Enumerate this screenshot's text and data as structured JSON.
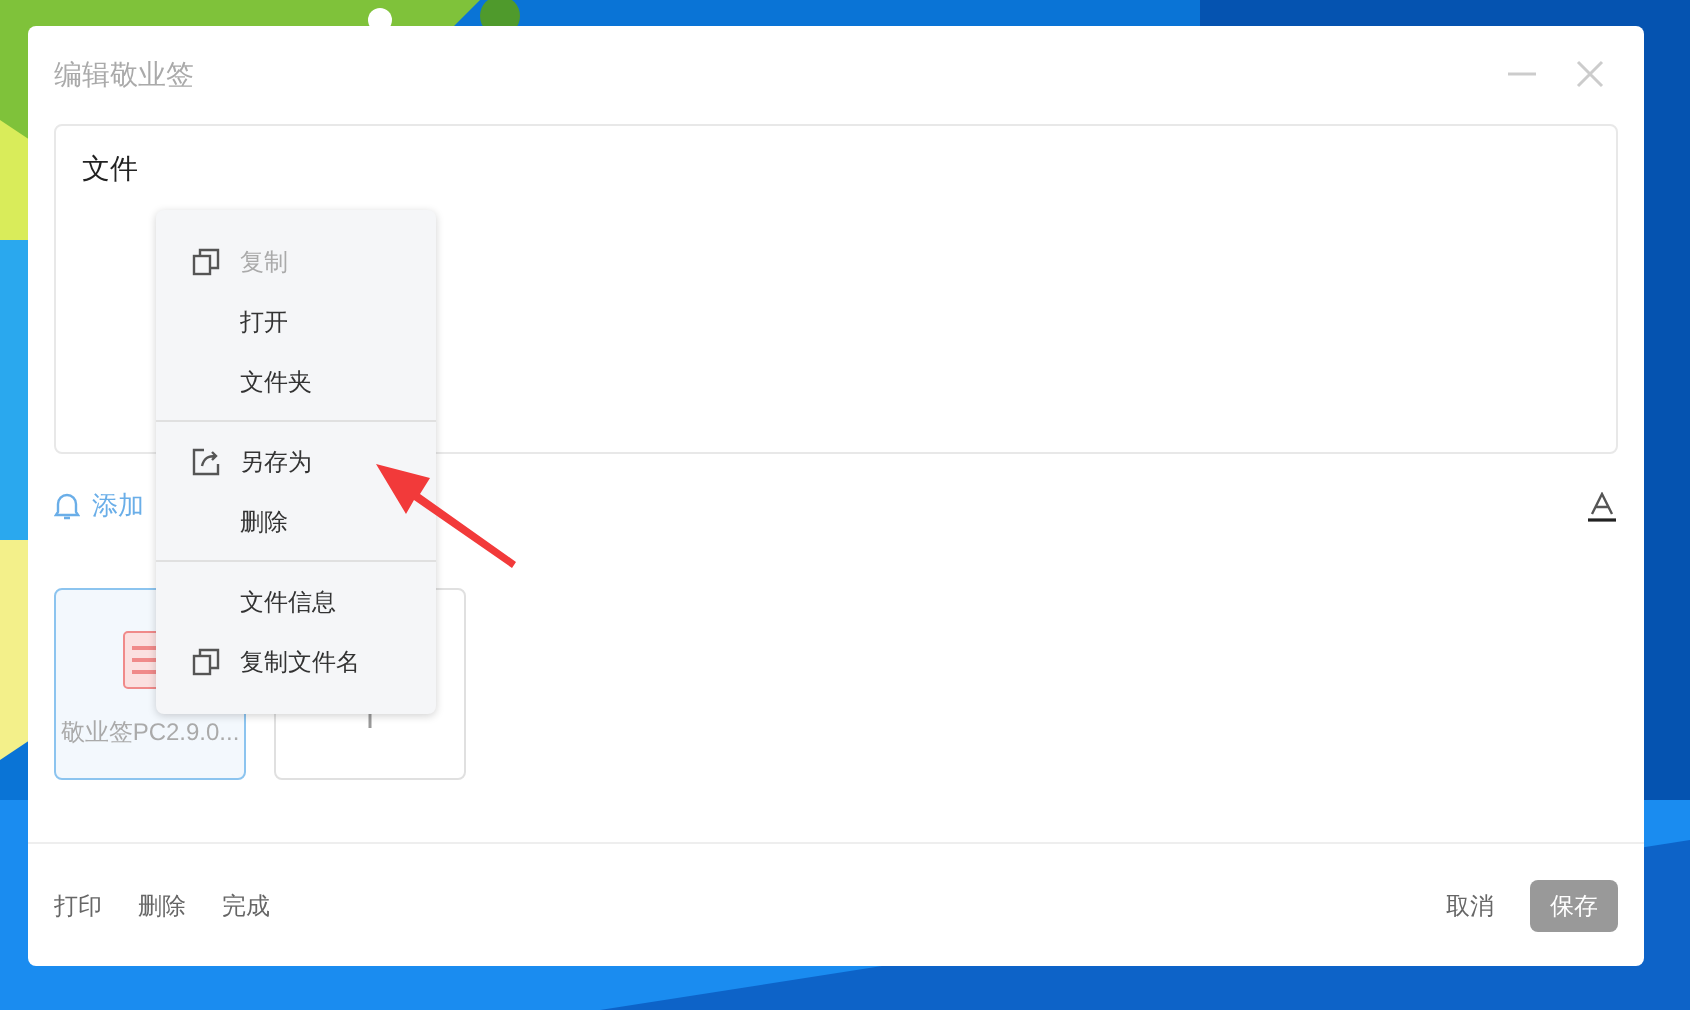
{
  "window": {
    "title": "编辑敬业签"
  },
  "editor": {
    "text": "文件"
  },
  "reminder": {
    "label": "添加"
  },
  "attachments": [
    {
      "kind": "file",
      "name": "敬业签PC2.9.0...",
      "selected": true
    },
    {
      "kind": "add",
      "selected": false
    }
  ],
  "context_menu": {
    "groups": [
      [
        {
          "kind": "copy",
          "label": "复制",
          "disabled": true
        },
        {
          "kind": "plain",
          "label": "打开",
          "disabled": false
        },
        {
          "kind": "plain",
          "label": "文件夹",
          "disabled": false
        }
      ],
      [
        {
          "kind": "export",
          "label": "另存为",
          "disabled": false
        },
        {
          "kind": "plain",
          "label": "删除",
          "disabled": false
        }
      ],
      [
        {
          "kind": "plain",
          "label": "文件信息",
          "disabled": false
        },
        {
          "kind": "copy",
          "label": "复制文件名",
          "disabled": false
        }
      ]
    ]
  },
  "footer": {
    "left_buttons": [
      "打印",
      "删除",
      "完成"
    ],
    "cancel": "取消",
    "save": "保存"
  }
}
